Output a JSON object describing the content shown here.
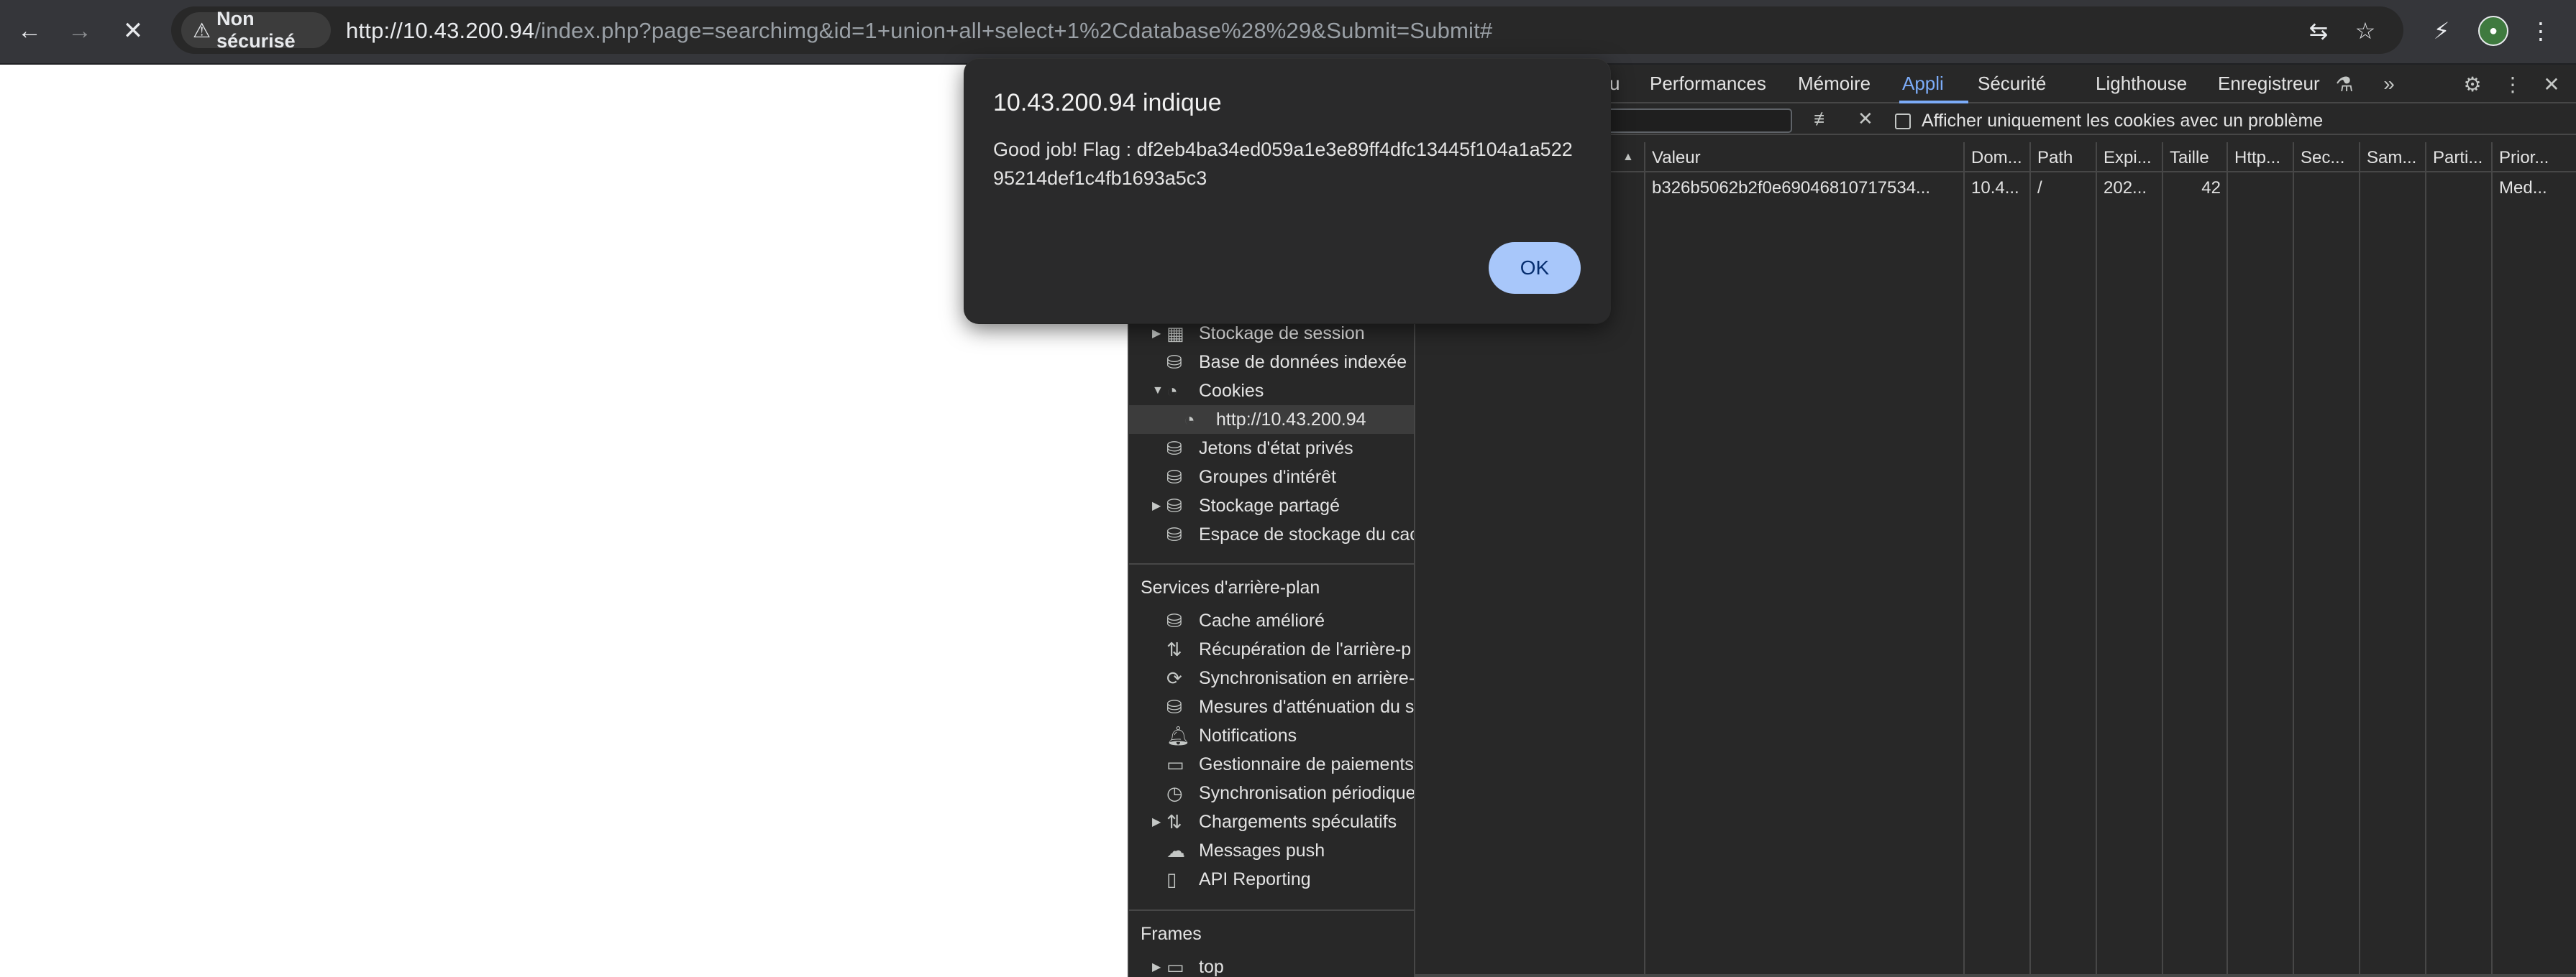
{
  "toolbar": {
    "back_icon": "arrow-left-icon",
    "forward_icon": "arrow-right-icon",
    "stop_icon": "close-icon",
    "security_label": "Non sécurisé",
    "url_host": "http://10.43.200.94",
    "url_path": "/index.php?page=searchimg&id=1+union+all+select+1%2Cdatabase%28%29&Submit=Submit#"
  },
  "devtools": {
    "tabs": [
      "u",
      "Performances",
      "Mémoire",
      "Appli",
      "Sécurité",
      "Lighthouse",
      "Enregistreur"
    ],
    "active_tab": "Appli",
    "filter": {
      "checkbox_label": "Afficher uniquement les cookies avec un problème"
    },
    "sidebar": {
      "items": [
        {
          "label": "Stockage de session"
        },
        {
          "label": "Base de données indexée"
        },
        {
          "label": "Cookies"
        },
        {
          "label": "http://10.43.200.94"
        },
        {
          "label": "Jetons d'état privés"
        },
        {
          "label": "Groupes d'intérêt"
        },
        {
          "label": "Stockage partagé"
        },
        {
          "label": "Espace de stockage du cac"
        }
      ],
      "section_background": "Services d'arrière-plan",
      "background_items": [
        {
          "label": "Cache amélioré"
        },
        {
          "label": "Récupération de l'arrière-p"
        },
        {
          "label": "Synchronisation en arrière-"
        },
        {
          "label": "Mesures d'atténuation du s"
        },
        {
          "label": "Notifications"
        },
        {
          "label": "Gestionnaire de paiements"
        },
        {
          "label": "Synchronisation périodique"
        },
        {
          "label": "Chargements spéculatifs"
        },
        {
          "label": "Messages push"
        },
        {
          "label": "API Reporting"
        }
      ],
      "section_frames": "Frames",
      "frames_items": [
        {
          "label": "top"
        }
      ]
    },
    "cookies_table": {
      "headers": [
        "Valeur",
        "Dom...",
        "Path",
        "Expi...",
        "Taille",
        "Http...",
        "Sec...",
        "Sam...",
        "Parti...",
        "Prior..."
      ],
      "rows": [
        {
          "valeur": "b326b5062b2f0e69046810717534...",
          "domain": "10.4...",
          "path": "/",
          "expires": "202...",
          "size": "42",
          "http": "",
          "secure": "",
          "samesite": "",
          "partition": "",
          "priority": "Med..."
        }
      ]
    }
  },
  "dialog": {
    "title": "10.43.200.94 indique",
    "message": "Good job! Flag : df2eb4ba34ed059a1e3e89ff4dfc13445f104a1a52295214def1c4fb1693a5c3",
    "ok_label": "OK"
  }
}
